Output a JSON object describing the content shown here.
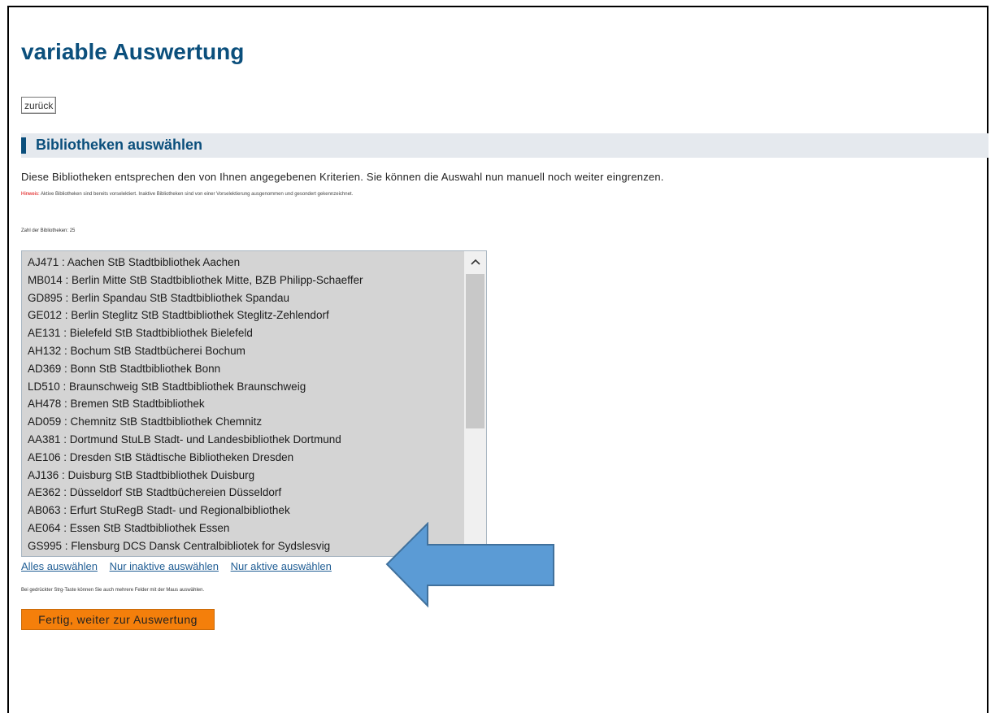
{
  "page": {
    "title": "variable Auswertung",
    "back_label": "zurück"
  },
  "section": {
    "title": "Bibliotheken auswählen",
    "intro": "Diese Bibliotheken entsprechen den von Ihnen angegebenen Kriterien. Sie können die Auswahl nun manuell noch weiter eingrenzen.",
    "hint_label": "Hinweis:",
    "hint_text": " Aktive Bibliotheken sind bereits vorselektiert. Inaktive Bibliotheken sind von einer Vorselektierung ausgenommen und gesondert gekennzeichnet.",
    "count_text": "Zahl der Bibliotheken: 25"
  },
  "library_list": [
    "AJ471 : Aachen StB Stadtbibliothek Aachen",
    "MB014 : Berlin Mitte StB Stadtbibliothek Mitte, BZB Philipp-Schaeffer",
    "GD895 : Berlin Spandau StB Stadtbibliothek Spandau",
    "GE012 : Berlin Steglitz StB Stadtbibliothek Steglitz-Zehlendorf",
    "AE131 : Bielefeld StB Stadtbibliothek Bielefeld",
    "AH132 : Bochum StB Stadtbücherei Bochum",
    "AD369 : Bonn StB Stadtbibliothek Bonn",
    "LD510 : Braunschweig StB Stadtbibliothek Braunschweig",
    "AH478 : Bremen StB Stadtbibliothek",
    "AD059 : Chemnitz StB Stadtbibliothek Chemnitz",
    "AA381 : Dortmund StuLB Stadt- und Landesbibliothek Dortmund",
    "AE106 : Dresden StB Städtische Bibliotheken Dresden",
    "AJ136 : Duisburg StB Stadtbibliothek Duisburg",
    "AE362 : Düsseldorf StB Stadtbüchereien Düsseldorf",
    "AB063 : Erfurt StuRegB Stadt- und Regionalbibliothek",
    "AE064 : Essen StB Stadtbibliothek Essen",
    "GS995 : Flensburg DCS Dansk Centralbibliotek for Sydslesvig"
  ],
  "selection_links": {
    "select_all": "Alles auswählen",
    "select_inactive": "Nur inaktive auswählen",
    "select_active": "Nur aktive auswählen"
  },
  "note": "Bei gedrückter Strg-Taste können Sie auch mehrere Felder mit der Maus auswählen.",
  "done_label": "Fertig, weiter zur Auswertung",
  "colors": {
    "title_blue": "#0b4f7c",
    "button_orange": "#f47f0b",
    "arrow_blue": "#5b9bd5",
    "list_bg": "#d4d4d4"
  }
}
